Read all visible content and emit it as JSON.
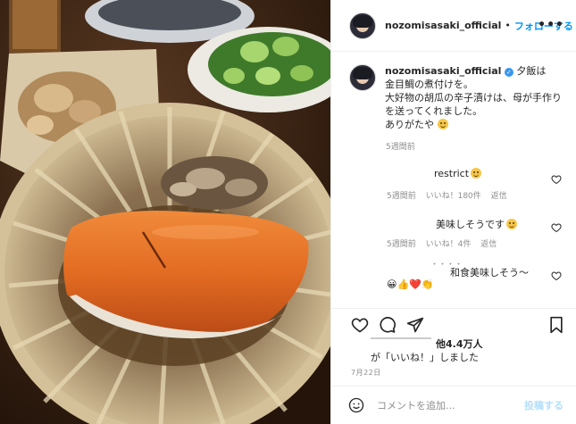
{
  "post": {
    "username": "nozomisasaki_official",
    "follow_label": "フォローする",
    "dot": "•",
    "more_label": "•••",
    "caption_lines": [
      "夕飯は",
      "金目鯛の煮付けを。",
      "大好物の胡瓜の辛子漬けは、母が手作り",
      "を送ってくれました。",
      "ありがたや"
    ],
    "caption_time": "5週間前"
  },
  "comments": [
    {
      "text": "restrict",
      "time": "5週間前",
      "likes": "いいね！180件",
      "reply": "返信"
    },
    {
      "text": "美味しそうです",
      "time": "5週間前",
      "likes": "いいね！4件",
      "reply": "返信"
    },
    {
      "text": "和食美味しそう〜",
      "dashes": "・・・・",
      "emoji_row": "😀👍❤️👏"
    }
  ],
  "stats": {
    "likes_count": "他4.4万人",
    "liked_by": "が「いいね！」しました",
    "date": "7月22日"
  },
  "composer": {
    "placeholder": "コメントを追加...",
    "post_label": "投稿する"
  },
  "colors": {
    "accent": "#0095f6",
    "verified": "#3897f0"
  }
}
